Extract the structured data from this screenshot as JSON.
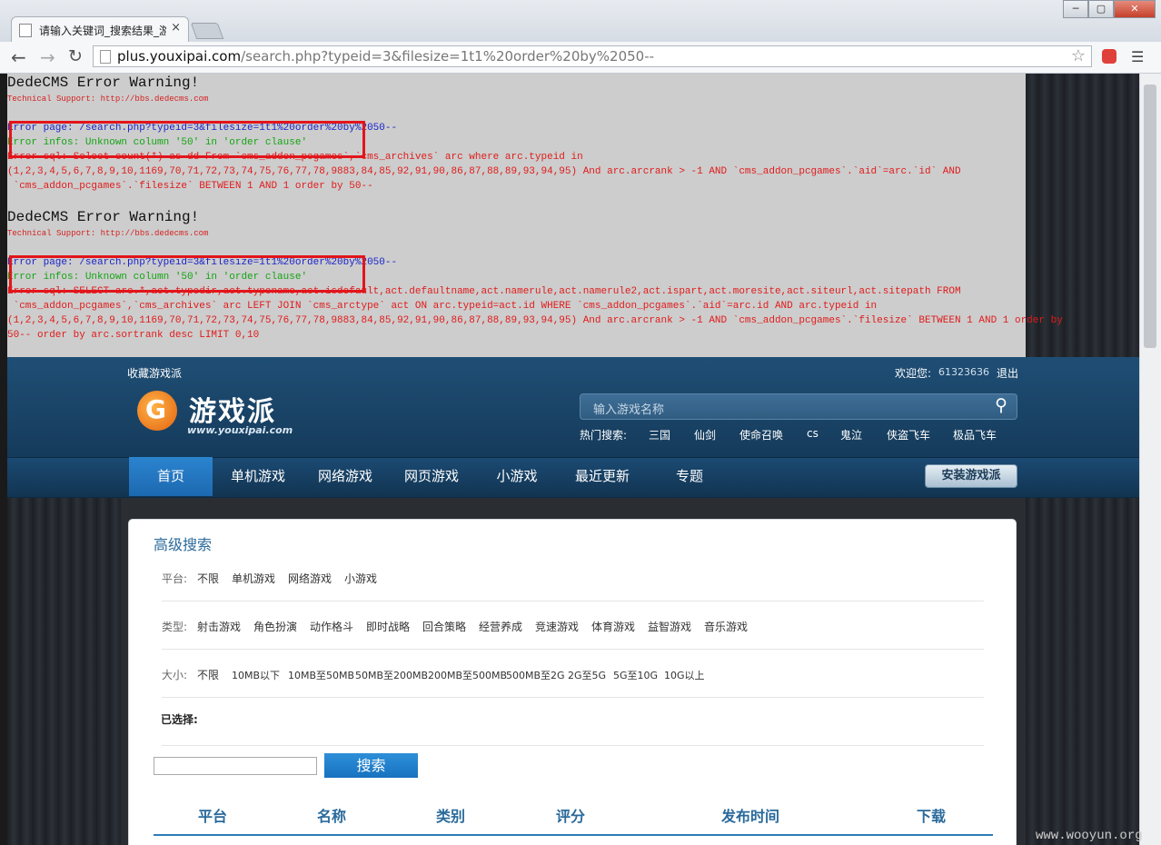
{
  "browser": {
    "tab_title": "请输入关键词_搜索结果_游",
    "tab_close": "×",
    "url_host": "plus.youxipai.com",
    "url_path": "/search.php?typeid=3&filesize=1t1%20order%20by%2050--",
    "window_controls": [
      "─",
      "▢",
      "✕"
    ]
  },
  "errors": {
    "warning_title_1": "DedeCMS Error Warning!",
    "tech_support_1": "Technical Support: http://bbs.dedecms.com",
    "error_page_1": "Error page: /search.php?typeid=3&filesize=1t1%20order%20by%2050--",
    "error_infos_1": "Error infos: Unknown column '50' in 'order clause'",
    "error_sql_1a": "Error sql: Select count(*) as dd From `cms_addon_pcgames`,`cms_archives` arc where arc.typeid in",
    "error_sql_1b": "(1,2,3,4,5,6,7,8,9,10,1169,70,71,72,73,74,75,76,77,78,9883,84,85,92,91,90,86,87,88,89,93,94,95) And arc.arcrank > -1 AND `cms_addon_pcgames`.`aid`=arc.`id` AND",
    "error_sql_1c": " `cms_addon_pcgames`.`filesize` BETWEEN 1 AND 1 order by 50--",
    "warning_title_2": "DedeCMS Error Warning!",
    "tech_support_2": "Technical Support: http://bbs.dedecms.com",
    "error_page_2": "Error page: /search.php?typeid=3&filesize=1t1%20order%20by%2050--",
    "error_infos_2": "Error infos: Unknown column '50' in 'order clause'",
    "error_sql_2a": "Error sql: SELECT arc.*,act.typedir,act.typename,act.isdefault,act.defaultname,act.namerule,act.namerule2,act.ispart,act.moresite,act.siteurl,act.sitepath FROM",
    "error_sql_2b": " `cms_addon_pcgames`,`cms_archives` arc LEFT JOIN `cms_arctype` act ON arc.typeid=act.id WHERE `cms_addon_pcgames`.`aid`=arc.id AND arc.typeid in",
    "error_sql_2c": "(1,2,3,4,5,6,7,8,9,10,1169,70,71,72,73,74,75,76,77,78,9883,84,85,92,91,90,86,87,88,89,93,94,95) And arc.arcrank > -1 AND `cms_addon_pcgames`.`filesize` BETWEEN 1 AND 1 order by",
    "error_sql_2d": "50-- order by arc.sortrank desc LIMIT 0,10"
  },
  "header": {
    "favorite": "收藏游戏派",
    "welcome_label": "欢迎您:",
    "username": "61323636",
    "logout": "退出",
    "logo_text": "游戏派",
    "logo_url": "www.youxipai.com",
    "search_placeholder": "输入游戏名称",
    "hot_label": "热门搜索:",
    "hot_items": [
      "三国",
      "仙剑",
      "使命召唤",
      "cs",
      "鬼泣",
      "侠盗飞车",
      "极品飞车"
    ]
  },
  "nav": {
    "items": [
      "首页",
      "单机游戏",
      "网络游戏",
      "网页游戏",
      "小游戏",
      "最近更新",
      "专题"
    ],
    "install_button": "安装游戏派"
  },
  "advanced_search": {
    "title": "高级搜索",
    "platform_label": "平台:",
    "platform_options": [
      "不限",
      "单机游戏",
      "网络游戏",
      "小游戏"
    ],
    "type_label": "类型:",
    "type_options": [
      "射击游戏",
      "角色扮演",
      "动作格斗",
      "即时战略",
      "回合策略",
      "经营养成",
      "竞速游戏",
      "体育游戏",
      "益智游戏",
      "音乐游戏"
    ],
    "size_label": "大小:",
    "size_options": [
      "不限",
      "10MB以下",
      "10MB至50MB",
      "50MB至200MB",
      "200MB至500MB",
      "500MB至2G",
      "2G至5G",
      "5G至10G",
      "10G以上"
    ],
    "selected_label": "已选择:",
    "search_button": "搜索",
    "keyword_value": ""
  },
  "results_table": {
    "headers": [
      "平台",
      "名称",
      "类别",
      "评分",
      "发布时间",
      "下载"
    ]
  },
  "watermark": "www.wooyun.org"
}
